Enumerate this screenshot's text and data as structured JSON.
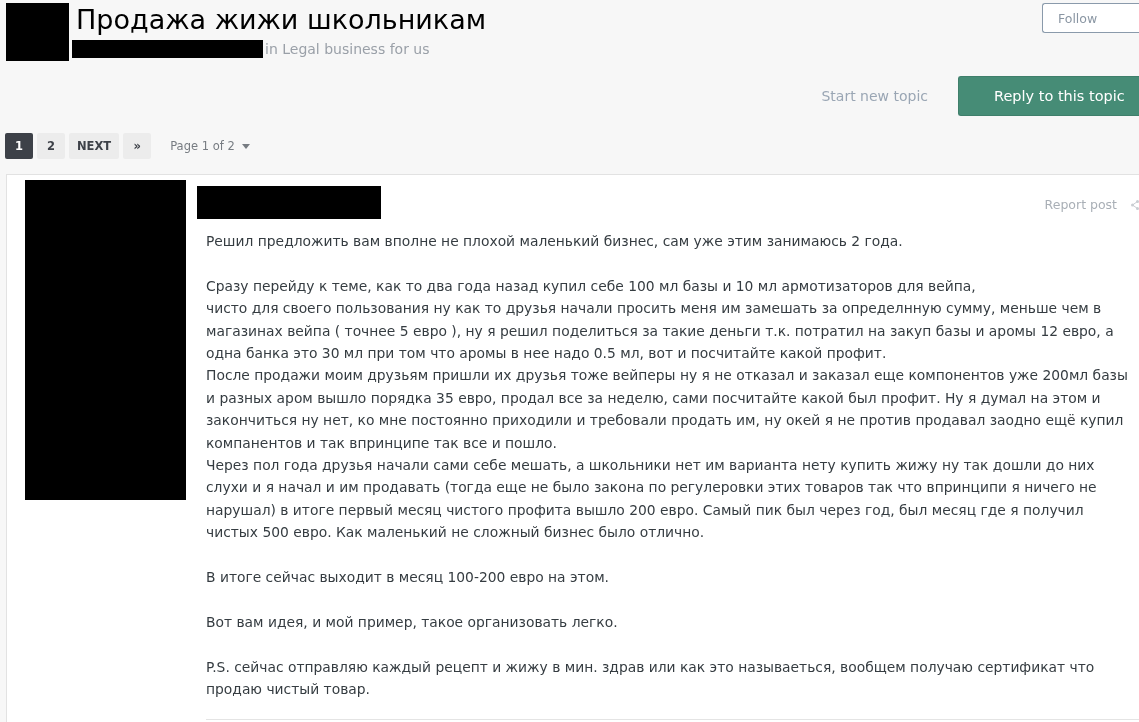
{
  "topic": {
    "title": "Продажа жижи школьникам",
    "forum_line": "in Legal business for us",
    "follow_button": "Follow"
  },
  "actions": {
    "start_link": "Start new topic",
    "reply_button": "Reply to this topic"
  },
  "pagination": {
    "pages": [
      {
        "label": "1",
        "selected": true
      },
      {
        "label": "2",
        "selected": false
      }
    ],
    "next": "NEXT",
    "last": "»",
    "page_jump": "Page 1 of 2"
  },
  "post": {
    "report_link": "Report post",
    "paragraphs": [
      {
        "lines": [
          "Решил предложить вам вполне не плохой маленький бизнес, сам уже этим занимаюсь 2 года."
        ]
      },
      {
        "lines": [
          "Сразу перейду к теме, как то два года назад купил себе 100 мл базы и 10 мл армотизаторов для вейпа,",
          "чисто для своего пользования ну как то друзья начали просить меня им замешать за определнную сумму, меньше чем в магазинах вейпа ( точнее 5 евро ), ну я решил поделиться за такие деньги т.к. потратил на закуп базы и аромы 12 евро, а одна банка это 30 мл при том что аромы в нее надо 0.5 мл, вот и посчитайте какой профит.",
          "После продажи моим друзьям пришли их друзья тоже вейперы ну я не отказал и заказал еще компонентов уже 200мл базы и разных аром вышло порядка 35 евро, продал все за неделю, сами посчитайте какой был профит. Ну я думал на этом и закончиться ну нет, ко мне постоянно приходили и требовали продать им, ну окей я не против продавал заодно ещё купил компанентов и так впринципе так все и пошло.",
          "Через пол года друзья начали сами себе мешать, а школьники нет им варианта нету купить жижу ну так дошли до них слухи и я начал и им продавать (тогда еще не было закона по регулеровки этих товаров так что впринципи я ничего не нарушал) в итоге первый месяц чистого профита вышло 200 евро. Самый пик был через год, был месяц где я получил чистых 500 евро. Как маленький не сложный бизнес было отлично."
        ]
      },
      {
        "lines": [
          "В итоге сейчас выходит в месяц 100-200 евро на этом."
        ]
      },
      {
        "lines": [
          "Вот вам идея, и мой пример, такое организовать легко."
        ]
      },
      {
        "lines": [
          "P.S. сейчас отправляю каждый рецепт и жижу в мин. здрав или как это называеться, вообщем получаю сертификат что продаю чистый товар."
        ]
      }
    ]
  }
}
